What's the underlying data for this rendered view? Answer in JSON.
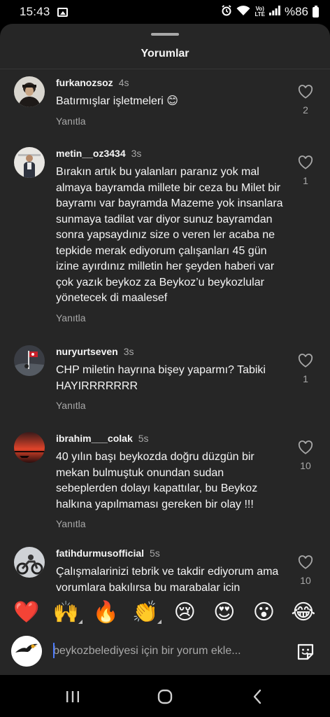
{
  "status_bar": {
    "time": "15:43",
    "battery": "%86",
    "network": "LTE"
  },
  "sheet": {
    "title": "Yorumlar"
  },
  "comments": [
    {
      "username": "furkanozsoz",
      "time": "4s",
      "text": "Batırmışlar işletmeleri 😊",
      "reply_label": "Yanıtla",
      "likes": "2"
    },
    {
      "username": "metin__oz3434",
      "time": "3s",
      "text": "Bırakın artık bu yalanları paranız yok mal almaya bayramda millete bir ceza bu Milet bir bayramı var bayramda Mazeme yok insanlara sunmaya tadilat var diyor sunuz bayramdan sonra yapsaydınız size o veren ler acaba ne tepkide merak ediyorum çalışanları 45 gün izine ayırdınız milletin her şeyden haberi var çok yazık beykoz za Beykoz’u beykozlular yönetecek di maalesef",
      "reply_label": "Yanıtla",
      "likes": "1"
    },
    {
      "username": "nuryurtseven",
      "time": "3s",
      "text": "CHP miletin hayrına bişey yaparmı? Tabiki HAYIRRRRRRR",
      "reply_label": "Yanıtla",
      "likes": "1"
    },
    {
      "username": "ibrahim___colak",
      "time": "5s",
      "text": "40 yılın başı beykozda doğru düzgün bir mekan bulmuştuk onundan sudan sebeplerden dolayı kapattılar, bu Beykoz halkına yapılmaması gereken bir olay !!!",
      "reply_label": "Yanıtla",
      "likes": "10"
    },
    {
      "username": "fatihdurmusofficial",
      "time": "5s",
      "text": "Çalışmalarinizi tebrik ve takdir ediyorum ama yorumlara bakılırsa bu marabalar için",
      "reply_label": "",
      "likes": "10"
    }
  ],
  "emoji_reactions": [
    "❤️",
    "🙌",
    "🔥",
    "👏",
    "😢",
    "😍",
    "😮",
    "😂"
  ],
  "composer": {
    "placeholder": "beykozbelediyesi için bir yorum ekle..."
  },
  "icons": {
    "like": "heart-outline-icon",
    "sticker": "sticker-icon",
    "recents": "recents-nav-icon",
    "home": "home-nav-icon",
    "back": "back-nav-icon"
  },
  "colors": {
    "sheet_bg": "#262626",
    "text_primary": "#f5f5f5",
    "text_secondary": "#a8a8a8",
    "cursor": "#4d7cff"
  }
}
